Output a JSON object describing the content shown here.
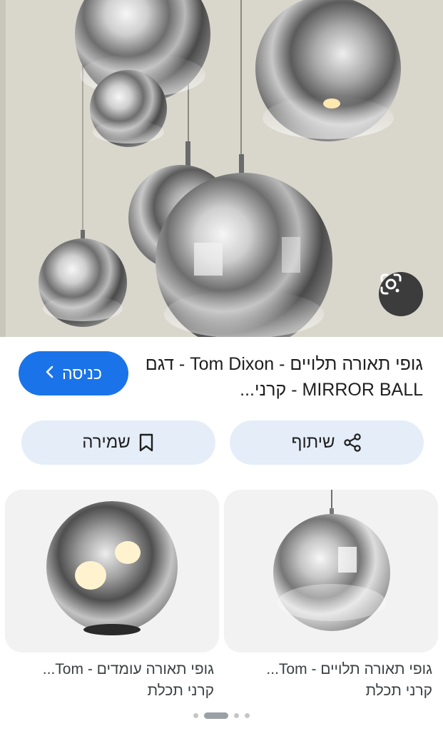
{
  "hero": {
    "image_subject": "mirror-ball-pendant-lamps",
    "lens_icon": "google-lens-icon"
  },
  "result": {
    "title": "גופי תאורה תלויים - Tom Dixon - דגם MIRROR BALL - קרני...",
    "visit_label": "כניסה",
    "visit_icon": "chevron-left-icon",
    "accent_color": "#1a73e8"
  },
  "actions": {
    "share_label": "שיתוף",
    "share_icon": "share-icon",
    "save_label": "שמירה",
    "save_icon": "bookmark-icon"
  },
  "related": [
    {
      "title": "גופי תאורה תלויים - Tom...",
      "source": "קרני תכלת"
    },
    {
      "title": "גופי תאורה עומדים - Tom...",
      "source": "קרני תכלת"
    }
  ],
  "pager": {
    "total": 4,
    "active": 1
  }
}
